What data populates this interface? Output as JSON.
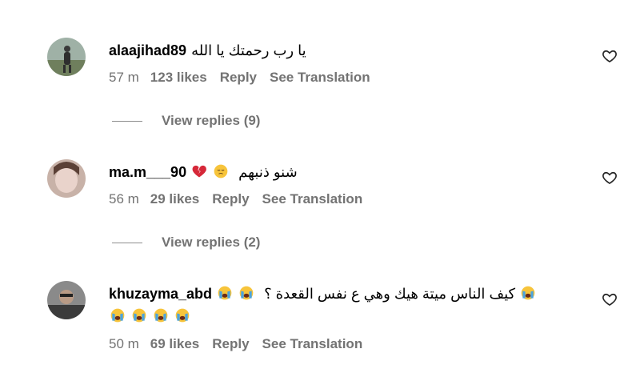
{
  "comments": [
    {
      "username": "alaajihad89",
      "text": "يا رب رحمتك يا الله",
      "time": "57 m",
      "likes": "123 likes",
      "reply": "Reply",
      "translate": "See Translation",
      "view_replies": "View replies (9)"
    },
    {
      "username": "ma.m___90",
      "text": "شنو ذنبهم",
      "emoji_after_text": [
        "broken-heart",
        "pensive-face"
      ],
      "time": "56 m",
      "likes": "29 likes",
      "reply": "Reply",
      "translate": "See Translation",
      "view_replies": "View replies (2)"
    },
    {
      "username": "khuzayma_abd",
      "text": "كيف الناس ميتة هيك وهي ع نفس القعدة ؟",
      "emoji_after_text": [
        "crying-face",
        "crying-face",
        "crying-face",
        "crying-face",
        "crying-face",
        "crying-face"
      ],
      "time": "50 m",
      "likes": "69 likes",
      "reply": "Reply",
      "translate": "See Translation"
    }
  ],
  "colors": {
    "meta_gray": "#737373",
    "divider": "#8e8e8e"
  }
}
